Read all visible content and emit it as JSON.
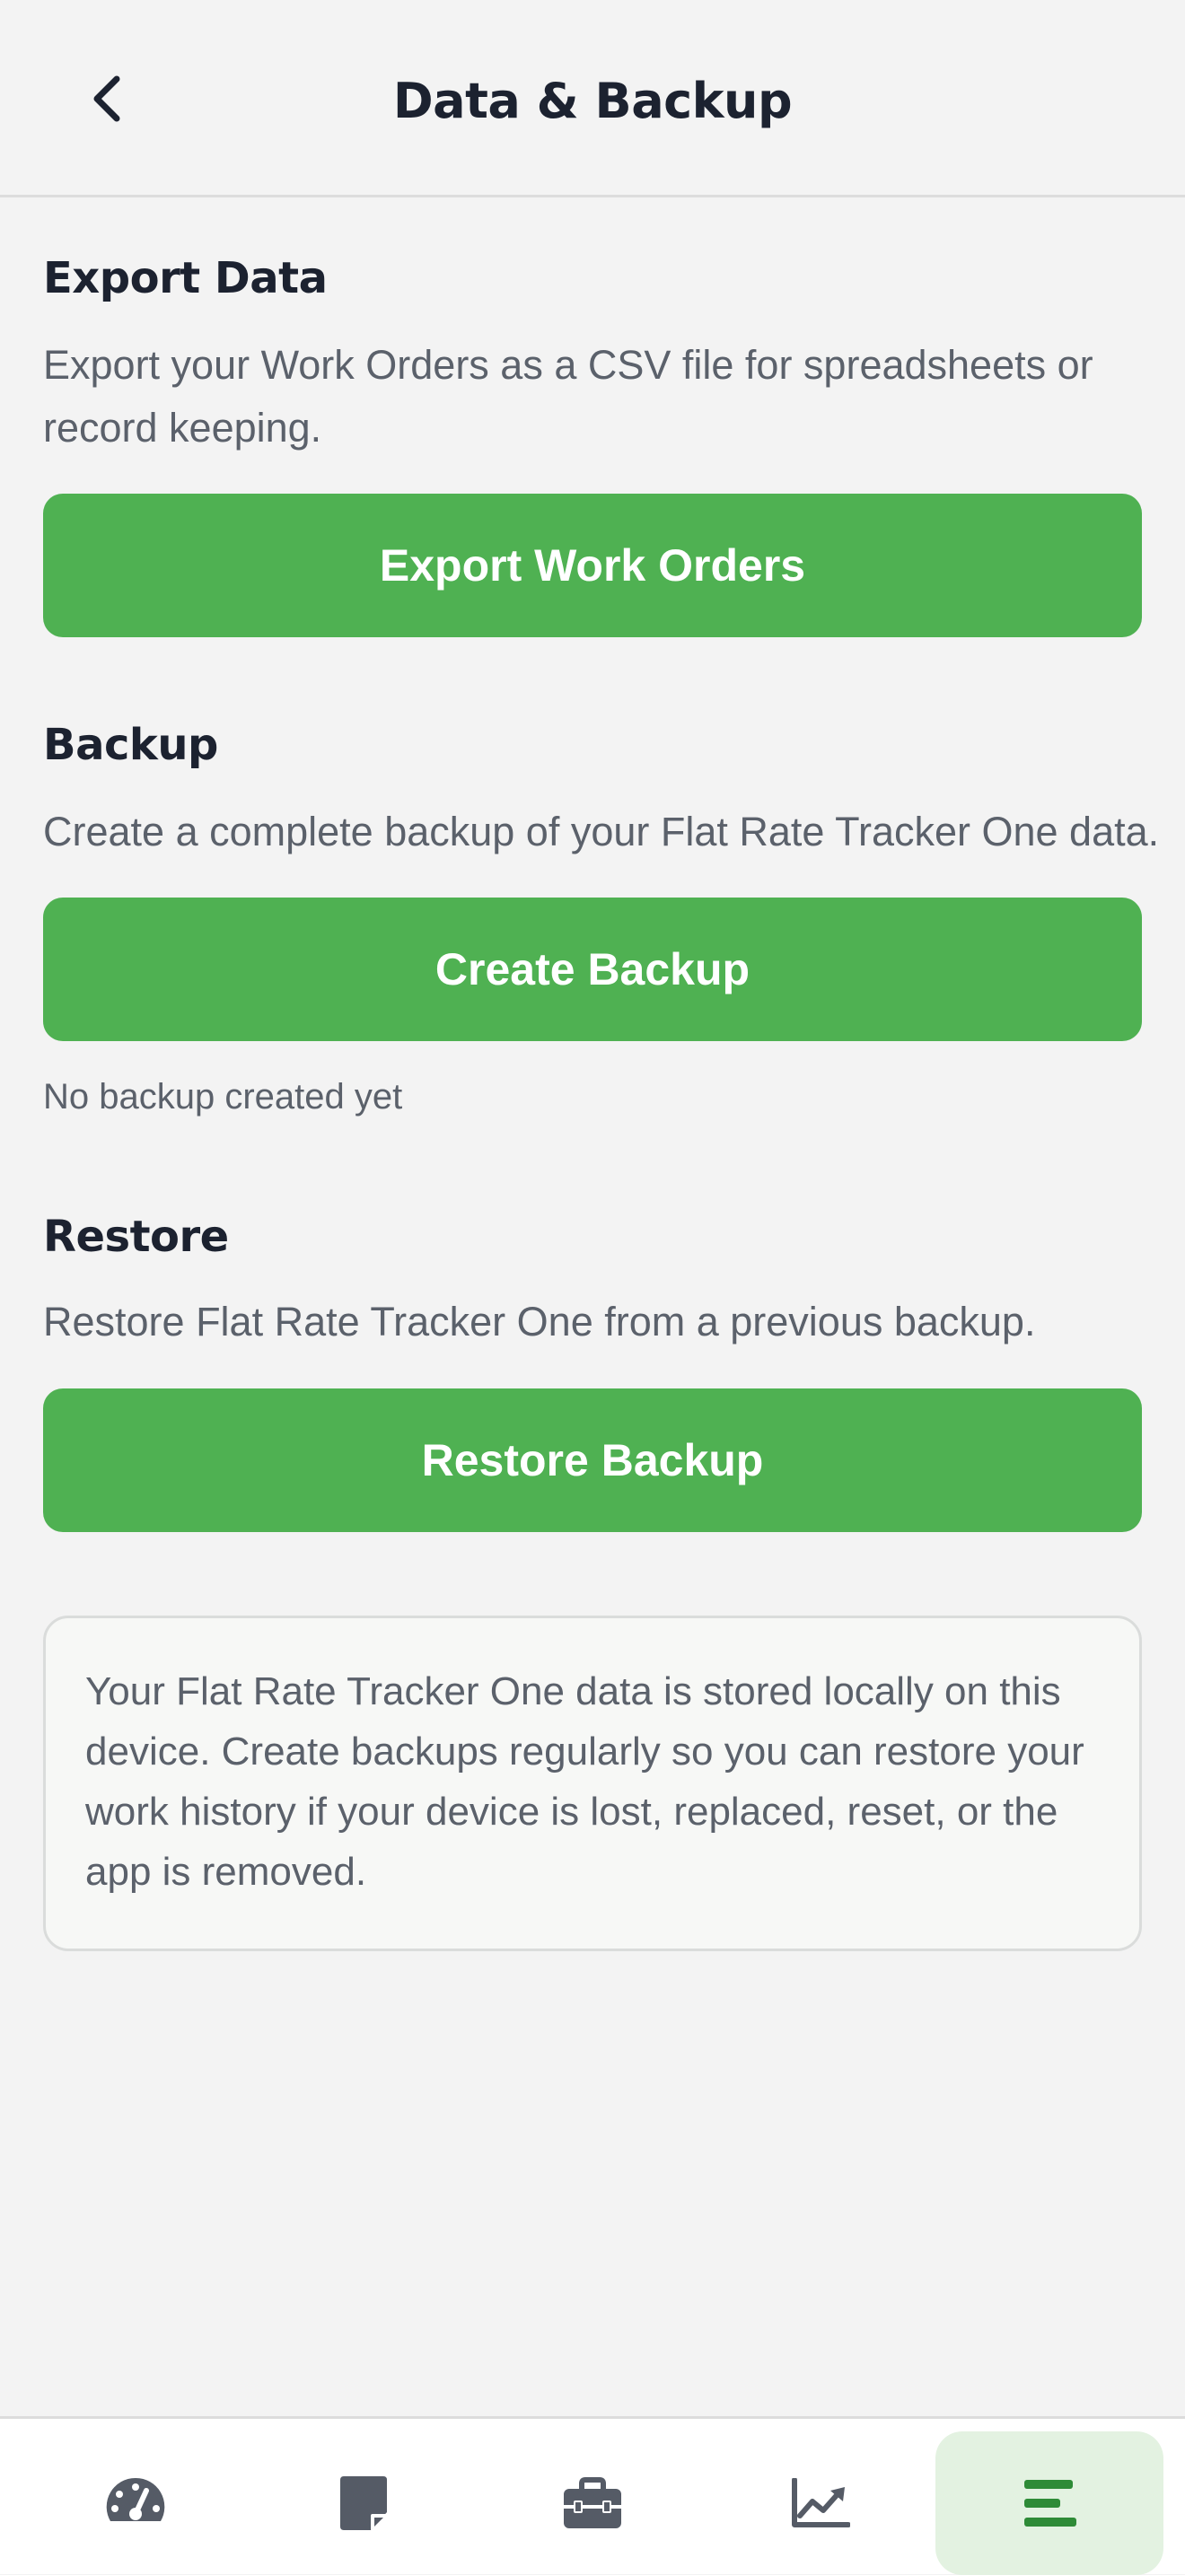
{
  "header": {
    "title": "Data & Backup",
    "back_icon": "chevron-left-icon"
  },
  "sections": {
    "export": {
      "heading": "Export Data",
      "description": "Export your Work Orders as a CSV file for spreadsheets or record keeping.",
      "button_label": "Export Work Orders"
    },
    "backup": {
      "heading": "Backup",
      "description": "Create a complete backup of your Flat Rate Tracker One data.",
      "button_label": "Create Backup",
      "status": "No backup created yet"
    },
    "restore": {
      "heading": "Restore",
      "description": "Restore Flat Rate Tracker One from a previous backup.",
      "button_label": "Restore Backup"
    }
  },
  "info_card": {
    "text": "Your Flat Rate Tracker One data is stored locally on this device. Create backups regularly so you can restore your work history if your device is lost, replaced, reset, or the app is removed."
  },
  "bottom_nav": {
    "items": [
      {
        "icon": "speedometer-icon",
        "active": false
      },
      {
        "icon": "note-icon",
        "active": false
      },
      {
        "icon": "toolbox-icon",
        "active": false
      },
      {
        "icon": "trend-chart-icon",
        "active": false
      },
      {
        "icon": "menu-icon",
        "active": true
      }
    ]
  },
  "colors": {
    "accent": "#4fb152",
    "accent_dark": "#2e8b37",
    "active_tab_bg": "#e3f2e1",
    "heading": "#1c2230",
    "body_text": "#5b616b",
    "nav_icon": "#555b66",
    "background": "#f3f3f3"
  }
}
